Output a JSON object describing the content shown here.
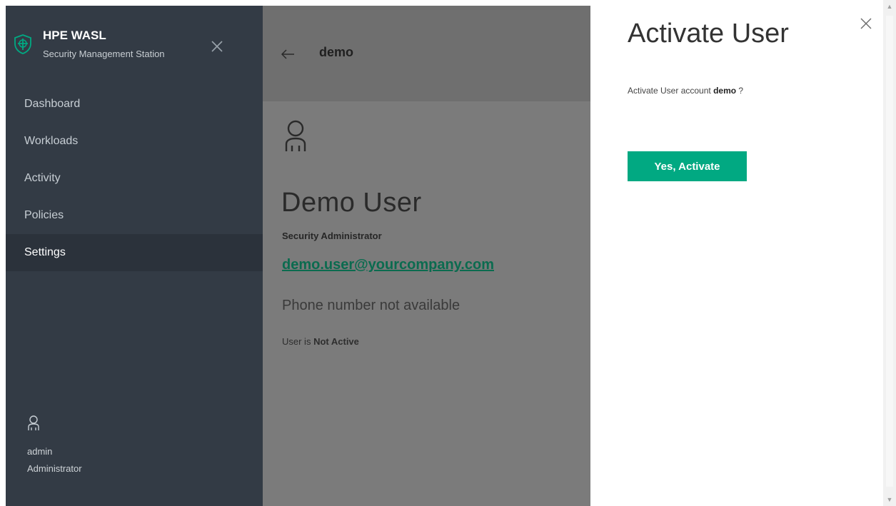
{
  "sidebar": {
    "brand_title": "HPE WASL",
    "brand_subtitle": "Security Management Station",
    "nav": [
      "Dashboard",
      "Workloads",
      "Activity",
      "Policies",
      "Settings"
    ],
    "active_item": "Settings",
    "user_name": "admin",
    "user_role": "Administrator"
  },
  "main": {
    "header_title": "demo",
    "name": "Demo User",
    "role": "Security Administrator",
    "email": "demo.user@yourcompany.com",
    "phone": "Phone number not available",
    "status_prefix": "User is",
    "status_value": "Not Active"
  },
  "panel": {
    "title": "Activate User",
    "prompt_prefix": "Activate User account",
    "prompt_user": "demo",
    "prompt_suffix": "?",
    "confirm_label": "Yes, Activate"
  },
  "colors": {
    "sidebar_bg": "#333b45",
    "accent": "#01a982",
    "overlay": "#7b7b7b"
  },
  "icons": {
    "brand": "shield-icon",
    "sidebar_close": "close-icon",
    "back": "arrow-left-icon",
    "profile": "user-icon",
    "panel_close": "close-icon"
  }
}
